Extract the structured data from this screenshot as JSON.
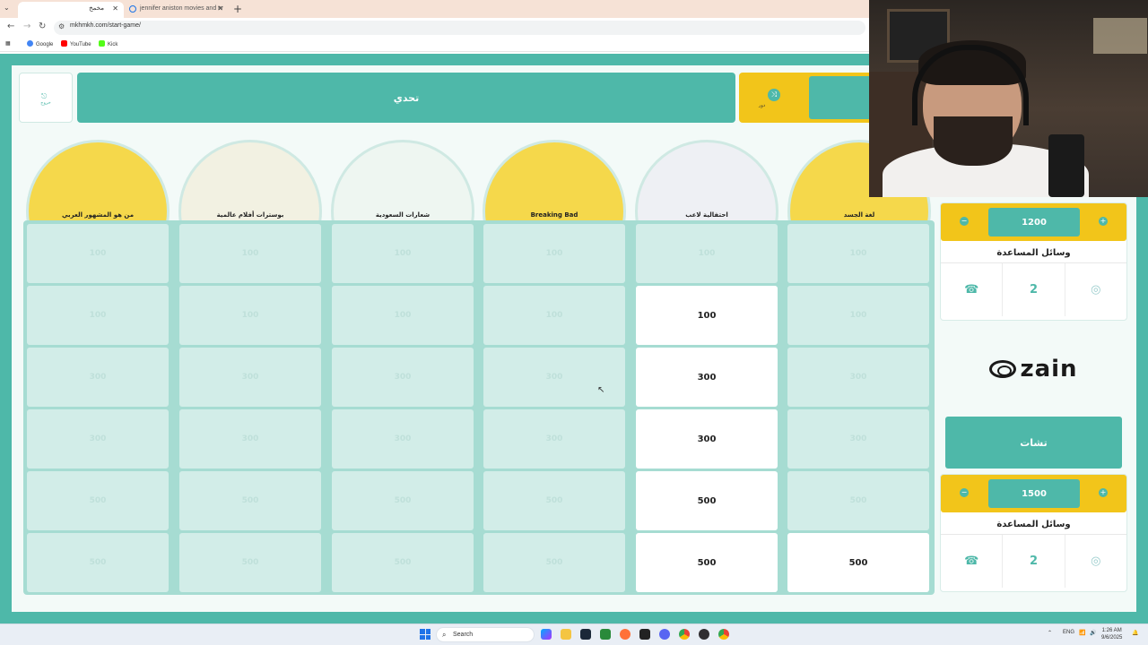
{
  "browser": {
    "tabs": [
      {
        "label": "مخمخ",
        "active": true
      },
      {
        "label": "jennifer aniston movies and tv",
        "active": false
      }
    ],
    "url": "mkhmkh.com/start-game/",
    "bookmarks": [
      {
        "label": "Google",
        "color": "#4285f4"
      },
      {
        "label": "YouTube",
        "color": "#ff0000"
      },
      {
        "label": "Kick",
        "color": "#53fc18"
      }
    ]
  },
  "game": {
    "exit_label": "خروج",
    "title": "تحدي",
    "turn_label": "دور",
    "categories": [
      {
        "label": "من هو المشهور العربي",
        "icon": "crowd-art",
        "color": "#f5d84b"
      },
      {
        "label": "بوسترات أفلام عالمية",
        "icon": "clapperboard-popcorn-art",
        "color": "#f2f1e2"
      },
      {
        "label": "شعارات السعودية",
        "icon": "saudi-logo-art",
        "color": "#eef6f1"
      },
      {
        "label": "Breaking Bad",
        "icon": "sunglasses-art",
        "color": "#f5d84b"
      },
      {
        "label": "احتفالية لاعب",
        "icon": "football-player-art",
        "color": "#eef0f4"
      },
      {
        "label": "لغة الجسد",
        "icon": "body-language-art",
        "color": "#f5d84b"
      }
    ],
    "board": [
      [
        {
          "value": "100",
          "open": false
        },
        {
          "value": "100",
          "open": false
        },
        {
          "value": "300",
          "open": false
        },
        {
          "value": "300",
          "open": false
        },
        {
          "value": "500",
          "open": false
        },
        {
          "value": "500",
          "open": false
        }
      ],
      [
        {
          "value": "100",
          "open": false
        },
        {
          "value": "100",
          "open": false
        },
        {
          "value": "300",
          "open": false
        },
        {
          "value": "300",
          "open": false
        },
        {
          "value": "500",
          "open": false
        },
        {
          "value": "500",
          "open": false
        }
      ],
      [
        {
          "value": "100",
          "open": false
        },
        {
          "value": "100",
          "open": false
        },
        {
          "value": "300",
          "open": false
        },
        {
          "value": "300",
          "open": false
        },
        {
          "value": "500",
          "open": false
        },
        {
          "value": "500",
          "open": false
        }
      ],
      [
        {
          "value": "100",
          "open": false
        },
        {
          "value": "100",
          "open": false
        },
        {
          "value": "300",
          "open": false
        },
        {
          "value": "300",
          "open": false
        },
        {
          "value": "500",
          "open": false
        },
        {
          "value": "500",
          "open": false
        }
      ],
      [
        {
          "value": "100",
          "open": false
        },
        {
          "value": "100",
          "open": true
        },
        {
          "value": "300",
          "open": true
        },
        {
          "value": "300",
          "open": true
        },
        {
          "value": "500",
          "open": true
        },
        {
          "value": "500",
          "open": true
        }
      ],
      [
        {
          "value": "100",
          "open": false
        },
        {
          "value": "100",
          "open": false
        },
        {
          "value": "300",
          "open": false
        },
        {
          "value": "300",
          "open": false
        },
        {
          "value": "500",
          "open": false
        },
        {
          "value": "500",
          "open": true
        }
      ]
    ],
    "teams": [
      {
        "score": "1200",
        "helps_title": "وسائل المساعدة",
        "helps": [
          "call-friend-icon",
          "double-points-icon",
          "hole-icon"
        ],
        "help_labels": [
          "",
          "2",
          ""
        ]
      },
      {
        "name": "تشات",
        "score": "1500",
        "helps_title": "وسائل المساعدة",
        "helps": [
          "call-friend-icon",
          "double-points-icon",
          "hole-icon"
        ],
        "help_labels": [
          "",
          "2",
          ""
        ]
      }
    ],
    "sponsor": "zain",
    "accent": "#4eb8a9",
    "yellow": "#f2c51a"
  },
  "taskbar": {
    "search_placeholder": "Search",
    "lang": "ENG",
    "time": "1:26 AM",
    "date": "9/6/2025"
  }
}
